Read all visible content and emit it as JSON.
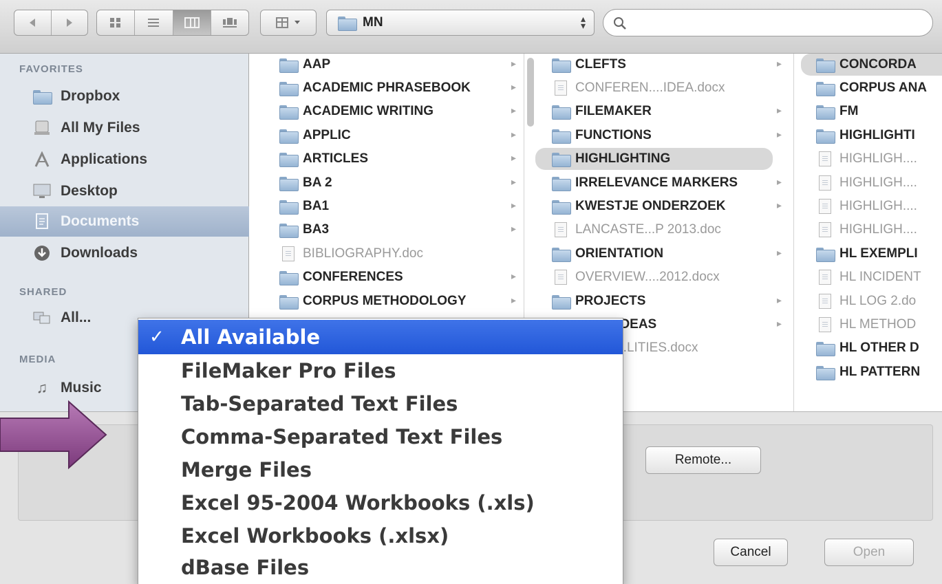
{
  "toolbar": {
    "path_label": "MN",
    "search_placeholder": ""
  },
  "sidebar": {
    "sections": [
      {
        "label": "FAVORITES",
        "items": [
          {
            "label": "Dropbox",
            "icon": "folder-icon"
          },
          {
            "label": "All My Files",
            "icon": "all-files-icon"
          },
          {
            "label": "Applications",
            "icon": "applications-icon"
          },
          {
            "label": "Desktop",
            "icon": "desktop-icon"
          },
          {
            "label": "Documents",
            "icon": "documents-icon",
            "selected": true
          },
          {
            "label": "Downloads",
            "icon": "downloads-icon"
          }
        ]
      },
      {
        "label": "SHARED",
        "items": [
          {
            "label": "All...",
            "icon": "network-icon"
          }
        ]
      },
      {
        "label": "MEDIA",
        "items": [
          {
            "label": "Music",
            "icon": "music-icon"
          }
        ]
      }
    ]
  },
  "columns": [
    [
      {
        "name": "AAP",
        "type": "folder"
      },
      {
        "name": "ACADEMIC PHRASEBOOK",
        "type": "folder"
      },
      {
        "name": "ACADEMIC WRITING",
        "type": "folder"
      },
      {
        "name": "APPLIC",
        "type": "folder"
      },
      {
        "name": "ARTICLES",
        "type": "folder"
      },
      {
        "name": "BA 2",
        "type": "folder"
      },
      {
        "name": "BA1",
        "type": "folder"
      },
      {
        "name": "BA3",
        "type": "folder"
      },
      {
        "name": "BIBLIOGRAPHY.doc",
        "type": "file"
      },
      {
        "name": "CONFERENCES",
        "type": "folder"
      },
      {
        "name": "CORPUS METHODOLOGY",
        "type": "folder"
      }
    ],
    [
      {
        "name": "CLEFTS",
        "type": "folder"
      },
      {
        "name": "CONFEREN....IDEA.docx",
        "type": "file"
      },
      {
        "name": "FILEMAKER",
        "type": "folder"
      },
      {
        "name": "FUNCTIONS",
        "type": "folder"
      },
      {
        "name": "HIGHLIGHTING",
        "type": "folder",
        "selected": true
      },
      {
        "name": "IRRELEVANCE  MARKERS",
        "type": "folder"
      },
      {
        "name": "KWESTJE ONDERZOEK",
        "type": "folder"
      },
      {
        "name": "LANCASTE...P 2013.doc",
        "type": "file"
      },
      {
        "name": "ORIENTATION",
        "type": "folder"
      },
      {
        "name": "OVERVIEW....2012.docx",
        "type": "file"
      },
      {
        "name": "PROJECTS",
        "type": "folder"
      },
      {
        "name": "ARCH IDEAS",
        "type": "folder"
      },
      {
        "name": "ARCH....LITIES.docx",
        "type": "file"
      }
    ],
    [
      {
        "name": "CONCORDA",
        "type": "folder",
        "selected": true
      },
      {
        "name": "CORPUS ANA",
        "type": "folder"
      },
      {
        "name": "FM",
        "type": "folder"
      },
      {
        "name": "HIGHLIGHTI",
        "type": "folder"
      },
      {
        "name": "HIGHLIGH....",
        "type": "file"
      },
      {
        "name": "HIGHLIGH....",
        "type": "file"
      },
      {
        "name": "HIGHLIGH....",
        "type": "file"
      },
      {
        "name": "HIGHLIGH....",
        "type": "file"
      },
      {
        "name": "HL EXEMPLI",
        "type": "folder"
      },
      {
        "name": "HL INCIDENT",
        "type": "file"
      },
      {
        "name": "HL LOG 2.do",
        "type": "file"
      },
      {
        "name": "HL METHOD",
        "type": "file"
      },
      {
        "name": "HL OTHER D",
        "type": "folder"
      },
      {
        "name": "HL PATTERN",
        "type": "folder"
      }
    ]
  ],
  "buttons": {
    "remote": "Remote...",
    "cancel": "Cancel",
    "open": "Open"
  },
  "file_type_menu": {
    "checkmark": "✓",
    "items": [
      {
        "label": "All Available",
        "selected": true
      },
      {
        "label": "FileMaker Pro Files"
      },
      {
        "label": "Tab-Separated Text Files"
      },
      {
        "label": "Comma-Separated Text Files"
      },
      {
        "label": "Merge Files"
      },
      {
        "label": "Excel 95-2004 Workbooks (.xls)"
      },
      {
        "label": "Excel Workbooks (.xlsx)"
      },
      {
        "label": "dBase Files"
      }
    ]
  },
  "colors": {
    "menu_highlight": "#2a5fdc",
    "annotation_arrow": "#8c4a8c",
    "sidebar_selection": "#a9b9cf"
  }
}
